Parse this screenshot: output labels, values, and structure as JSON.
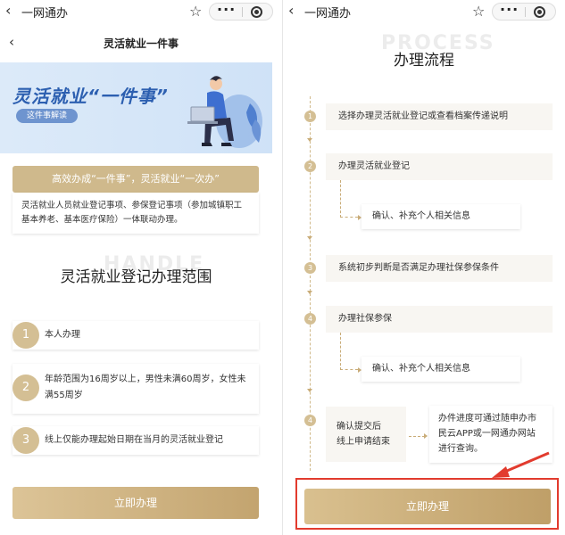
{
  "left": {
    "topbar": {
      "title": "一网通办"
    },
    "header": {
      "title": "灵活就业一件事"
    },
    "banner": {
      "title": "灵活就业“一件事”",
      "badge": "这件事解读"
    },
    "slogan": "高效办成“一件事”，灵活就业“一次办”",
    "description": "灵活就业人员就业登记事项、参保登记事项（参加城镇职工基本养老、基本医疗保险）一体联动办理。",
    "watermark": "HANDLE",
    "scope_title": "灵活就业登记办理范围",
    "scope_items": [
      {
        "num": "1",
        "text": "本人办理"
      },
      {
        "num": "2",
        "text": "年龄范围为16周岁以上，男性未满60周岁，女性未满55周岁"
      },
      {
        "num": "3",
        "text": "线上仅能办理起始日期在当月的灵活就业登记"
      }
    ],
    "button": "立即办理"
  },
  "right": {
    "topbar": {
      "title": "一网通办"
    },
    "watermark": "PROCESS",
    "title": "办理流程",
    "steps": [
      {
        "num": "1",
        "text": "选择办理灵活就业登记或查看档案传递说明"
      },
      {
        "num": "2",
        "text": "办理灵活就业登记",
        "sub": "确认、补充个人相关信息"
      },
      {
        "num": "3",
        "text": "系统初步判断是否满足办理社保参保条件"
      },
      {
        "num": "4",
        "text": "办理社保参保",
        "sub": "确认、补充个人相关信息"
      },
      {
        "num": "4",
        "text_line1": "确认提交后",
        "text_line2": "线上申请结束",
        "note_line1": "办件进度可通过随申办市",
        "note_line2": "民云APP或一网通办网站",
        "note_line3": "进行查询。"
      }
    ],
    "button": "立即办理"
  },
  "colors": {
    "gold": "#cfb98c",
    "highlight": "#e23b2e",
    "banner_blue": "#2c5fb0"
  }
}
